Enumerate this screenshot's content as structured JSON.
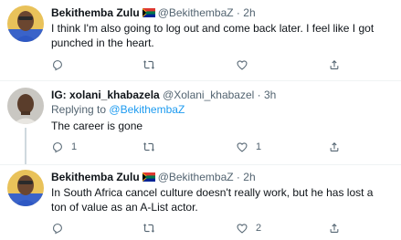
{
  "tweets": [
    {
      "name": "Bekithemba Zulu",
      "handle": "@BekithembaZ",
      "dot": "·",
      "time": "2h",
      "text": "I think I'm also going to log out and come back later. I feel like I got punched in the heart.",
      "actions": {
        "reply": "",
        "retweet": "",
        "like": ""
      }
    },
    {
      "name": "IG: xolani_khabazela",
      "handle": "@Xolani_khabazel",
      "dot": "·",
      "time": "3h",
      "replying_prefix": "Replying to",
      "replying_to": "@BekithembaZ",
      "text": "The career is gone",
      "actions": {
        "reply": "1",
        "retweet": "",
        "like": "1"
      }
    },
    {
      "name": "Bekithemba Zulu",
      "handle": "@BekithembaZ",
      "dot": "·",
      "time": "2h",
      "text": "In South Africa cancel culture doesn't really work, but he has lost a ton of value as an A-List actor.",
      "actions": {
        "reply": "",
        "retweet": "",
        "like": "2"
      }
    }
  ],
  "icons": {
    "reply": "reply-icon",
    "retweet": "retweet-icon",
    "like": "like-icon",
    "share": "share-icon",
    "flag": "south-africa-flag-icon"
  },
  "colors": {
    "link": "#1d9bf0",
    "muted": "#536471",
    "text": "#0f1419",
    "divider": "#eff3f4"
  }
}
